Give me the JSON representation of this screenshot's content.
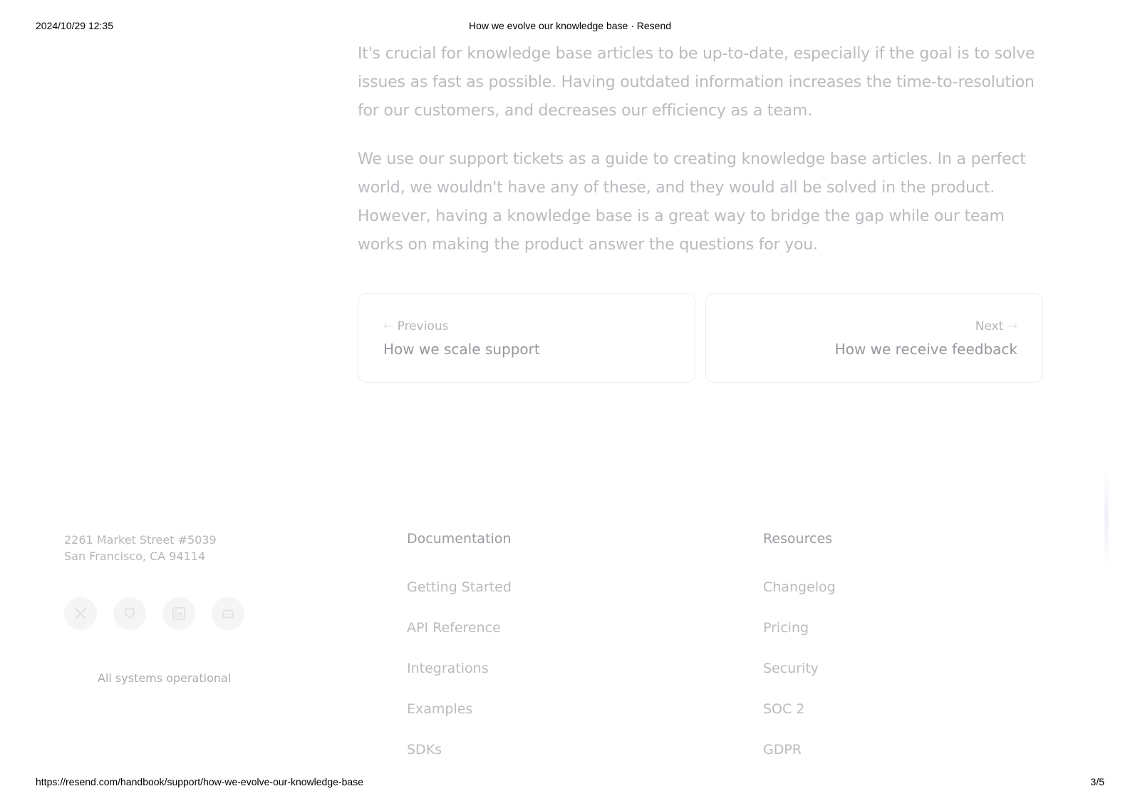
{
  "print": {
    "datetime": "2024/10/29 12:35",
    "title": "How we evolve our knowledge base · Resend",
    "url": "https://resend.com/handbook/support/how-we-evolve-our-knowledge-base",
    "page": "3/5"
  },
  "article": {
    "paragraphs": [
      "It's crucial for knowledge base articles to be up-to-date, especially if the goal is to solve issues as fast as possible. Having outdated information increases the time-to-resolution for our customers, and decreases our efficiency as a team.",
      "We use our support tickets as a guide to creating knowledge base articles. In a perfect world, we wouldn't have any of these, and they would all be solved in the product. However, having a knowledge base is a great way to bridge the gap while our team works on making the product answer the questions for you."
    ]
  },
  "navigation": {
    "previous": {
      "kicker": "Previous",
      "title": "How we scale support",
      "icon": "arrow-left-icon"
    },
    "next": {
      "kicker": "Next",
      "title": "How we receive feedback",
      "icon": "arrow-right-icon"
    }
  },
  "footer": {
    "address_line1": "2261 Market Street #5039",
    "address_line2": "San Francisco, CA 94114",
    "socials": [
      "x-icon",
      "github-icon",
      "linkedin-icon",
      "discord-icon"
    ],
    "status": "All systems operational",
    "documentation": {
      "heading": "Documentation",
      "links": [
        "Getting Started",
        "API Reference",
        "Integrations",
        "Examples",
        "SDKs"
      ]
    },
    "resources": {
      "heading": "Resources",
      "links": [
        "Changelog",
        "Pricing",
        "Security",
        "SOC 2",
        "GDPR"
      ]
    }
  },
  "colors": {
    "body_text": "#b9bbbf",
    "card_border": "#ececee",
    "social_bg": "#f5f5f6"
  }
}
